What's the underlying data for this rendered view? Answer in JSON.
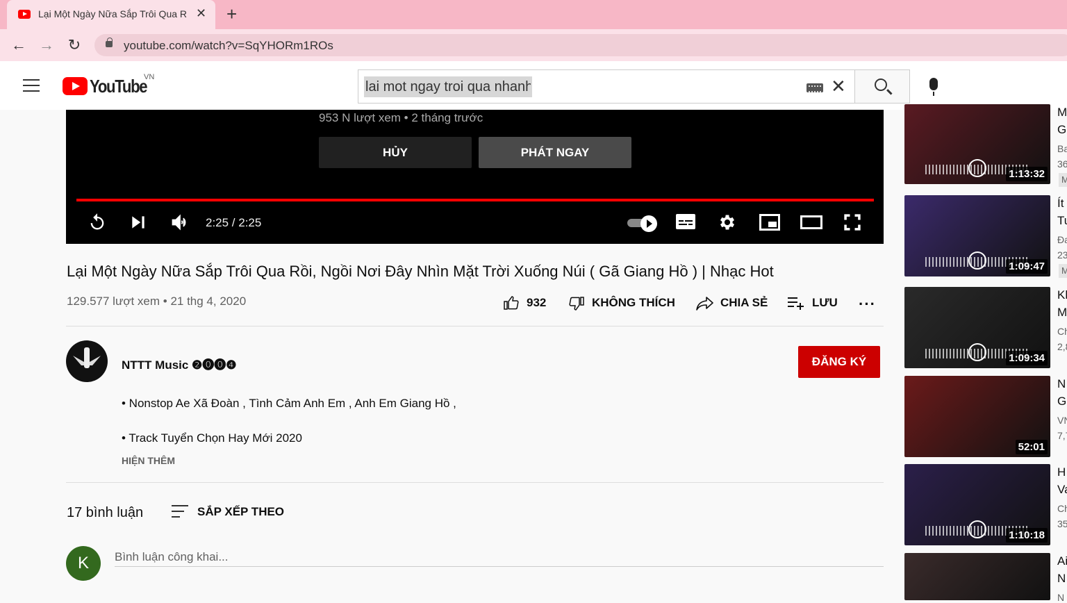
{
  "browser": {
    "tab_title": "Lại Một Ngày Nữa Sắp Trôi Qua R",
    "url": "youtube.com/watch?v=SqYHORm1ROs"
  },
  "header": {
    "logo_text": "YouTube",
    "region": "VN",
    "search_value": "lai mot ngay troi qua nhanh"
  },
  "player": {
    "endscreen_meta": "953 N lượt xem • 2 tháng trước",
    "cancel_label": "HỦY",
    "play_now_label": "PHÁT NGAY",
    "time": "2:25 / 2:25",
    "progress": 1.0
  },
  "video": {
    "title": "Lại Một Ngày Nữa Sắp Trôi Qua Rồi, Ngồi Nơi Đây Nhìn Mặt Trời Xuống Núi ( Gã Giang Hồ ) | Nhạc Hot",
    "meta": "129.577 lượt xem • 21 thg 4, 2020",
    "likes": "932",
    "dislike_label": "KHÔNG THÍCH",
    "share_label": "CHIA SẺ",
    "save_label": "LƯU"
  },
  "channel": {
    "name": "NTTT Music ❷⓿⓿❹",
    "subscribe_label": "ĐĂNG KÝ"
  },
  "description": {
    "line1": "• Nonstop Ae Xã Đoàn ,  Tình Cảm Anh Em , Anh Em Giang Hồ ,",
    "line2": "• Track Tuyển Chọn Hay Mới 2020",
    "show_more": "HIỆN THÊM"
  },
  "comments": {
    "count_label": "17 bình luận",
    "sort_label": "SẮP XẾP THEO",
    "user_initial": "K",
    "placeholder": "Bình luận công khai..."
  },
  "sidebar": [
    {
      "duration": "1:13:32",
      "line1": "M",
      "line2": "Gi",
      "sub1": "Ba",
      "sub2": "36",
      "badge": "M",
      "color": "#5a1a22"
    },
    {
      "duration": "1:09:47",
      "line1": "Ít",
      "line2": "Tu",
      "sub1": "Đa",
      "sub2": "23",
      "badge": "M",
      "color": "#3b2a6b"
    },
    {
      "duration": "1:09:34",
      "line1": "Kh",
      "line2": "M",
      "sub1": "Ch",
      "sub2": "2,8",
      "badge": "",
      "color": "#2a2a2a"
    },
    {
      "duration": "52:01",
      "line1": "N",
      "line2": "Gi",
      "sub1": "VN",
      "sub2": "7,7",
      "badge": "",
      "color": "#6b1a1a"
    },
    {
      "duration": "1:10:18",
      "line1": "H",
      "line2": "Va",
      "sub1": "Ch",
      "sub2": "35",
      "badge": "",
      "color": "#2b1f4a"
    },
    {
      "duration": "",
      "line1": "Ai",
      "line2": "N",
      "sub1": "N",
      "sub2": "",
      "badge": "",
      "color": "#3a2b2b"
    }
  ]
}
